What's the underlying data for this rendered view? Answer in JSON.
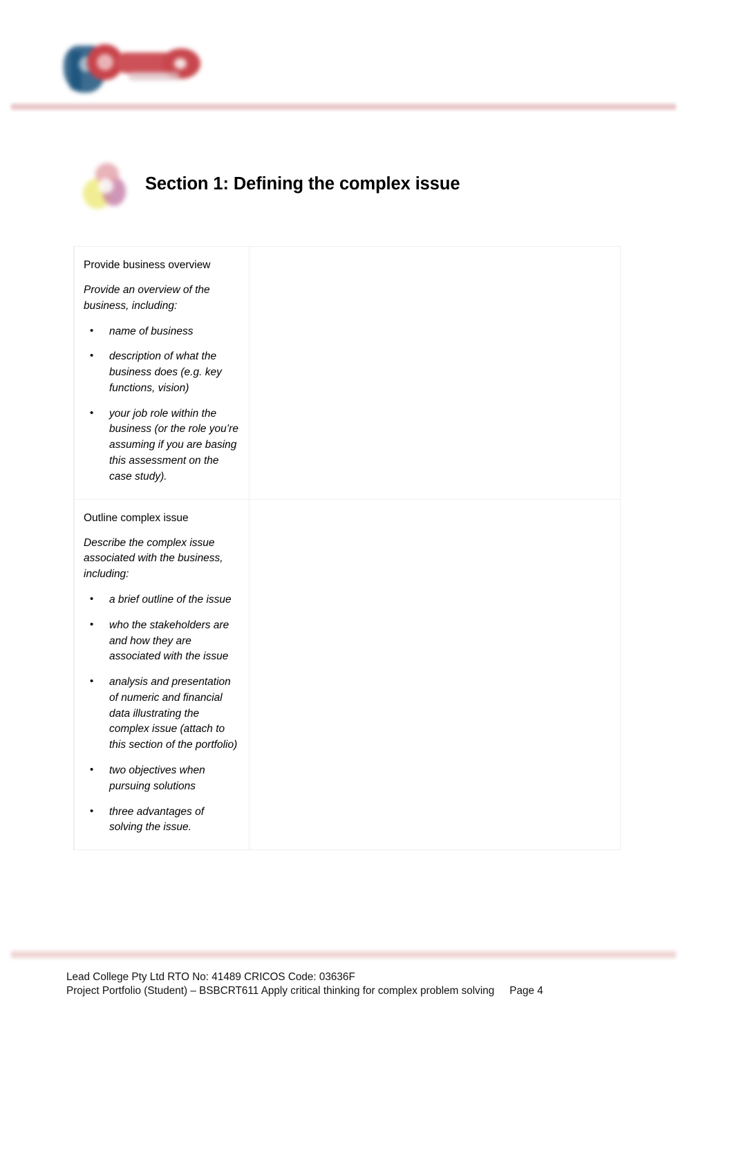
{
  "document": {
    "header": {
      "logo_alt": "Lead College logo",
      "rule_color": "#e8c5c7"
    },
    "section": {
      "icon_name": "colored-blobs-icon",
      "title": "Section 1: Defining the complex issue"
    },
    "table": {
      "rows": [
        {
          "prompt_title": "Provide business overview",
          "prompt_lead": "Provide an overview of the business, including:",
          "bullets": [
            "name of business",
            "description of what the business does (e.g. key functions, vision)",
            "your job role within the business (or the role you’re assuming if you are basing this assessment on the case study)."
          ],
          "answer": ""
        },
        {
          "prompt_title": "Outline complex issue",
          "prompt_lead": "Describe the complex issue associated with the business, including:",
          "bullets": [
            "a brief outline of the issue",
            "who the stakeholders are and how they are associated with the issue",
            "analysis and presentation of numeric and financial data illustrating the complex issue (attach to this section of the portfolio)",
            "two objectives when pursuing solutions",
            "three advantages of solving the issue."
          ],
          "answer": ""
        }
      ]
    },
    "footer": {
      "line1": "Lead College Pty Ltd RTO No: 41489 CRICOS Code: 03636F",
      "line2": "Project Portfolio (Student) – BSBCRT611 Apply critical thinking for complex problem solving",
      "page": "Page 4",
      "rule_color": "#eed3d0"
    }
  }
}
